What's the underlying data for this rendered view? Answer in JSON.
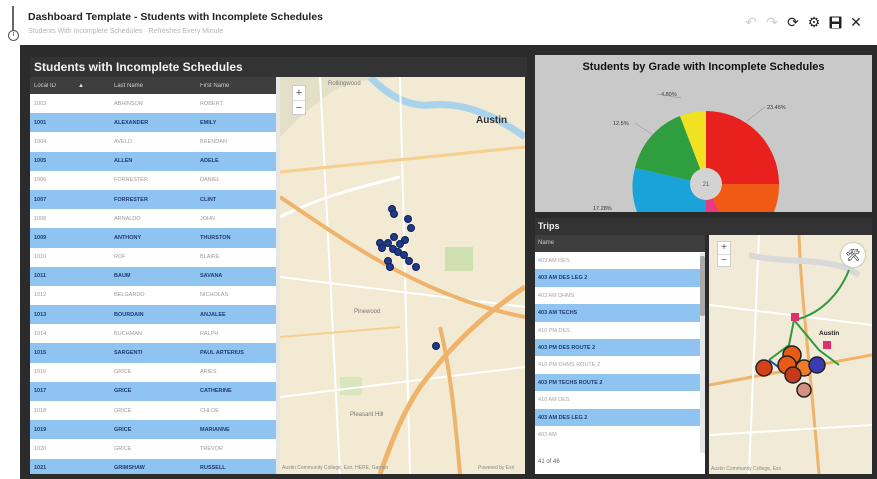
{
  "header": {
    "title": "Dashboard Template - Students with Incomplete Schedules",
    "subtitle": "Students With Incomplete Schedules · Refreshes Every Minute",
    "info_glyph": "i"
  },
  "toolbar": {
    "undo_icon": "↶",
    "redo_icon": "↷",
    "refresh_icon": "⟳",
    "settings_icon": "⚙",
    "save_icon": "💾",
    "close_icon": "✕"
  },
  "students_panel": {
    "title": "Students with Incomplete Schedules",
    "columns": [
      "Local ID",
      "Last Name",
      "First Name"
    ],
    "sort_icon": "▲",
    "rows": [
      {
        "id": "1003",
        "last": "Abhinson",
        "first": "Robert",
        "hl": false
      },
      {
        "id": "1001",
        "last": "Alexander",
        "first": "Emily",
        "hl": true
      },
      {
        "id": "1004",
        "last": "Avelo",
        "first": "Brendan",
        "hl": false
      },
      {
        "id": "1005",
        "last": "Allen",
        "first": "Adele",
        "hl": true
      },
      {
        "id": "1006",
        "last": "Forrester",
        "first": "Daniel",
        "hl": false
      },
      {
        "id": "1007",
        "last": "Forrester",
        "first": "Clint",
        "hl": true
      },
      {
        "id": "1008",
        "last": "Arnaldo",
        "first": "John",
        "hl": false
      },
      {
        "id": "1009",
        "last": "Anthony",
        "first": "Thurston",
        "hl": true
      },
      {
        "id": "1010",
        "last": "Rof",
        "first": "Blaire",
        "hl": false
      },
      {
        "id": "1011",
        "last": "Baum",
        "first": "Savana",
        "hl": true
      },
      {
        "id": "1012",
        "last": "Belgardo",
        "first": "Nicholas",
        "hl": false
      },
      {
        "id": "1013",
        "last": "Bourdain",
        "first": "Anjalee",
        "hl": true
      },
      {
        "id": "1014",
        "last": "Buchman",
        "first": "Ralph",
        "hl": false
      },
      {
        "id": "1015",
        "last": "Sargenti",
        "first": "Paul Arterius",
        "hl": true
      },
      {
        "id": "1016",
        "last": "Grice",
        "first": "Aries",
        "hl": false
      },
      {
        "id": "1017",
        "last": "Grice",
        "first": "Catherine",
        "hl": true
      },
      {
        "id": "1018",
        "last": "Grice",
        "first": "Chloe",
        "hl": false
      },
      {
        "id": "1019",
        "last": "Grice",
        "first": "Marianne",
        "hl": true
      },
      {
        "id": "1020",
        "last": "Grice",
        "first": "Trevor",
        "hl": false
      },
      {
        "id": "1021",
        "last": "Grimshaw",
        "first": "Russell",
        "hl": true
      }
    ]
  },
  "map1": {
    "city_label": "Austin",
    "place_labels": [
      "Rollingwood",
      "Pleasant Hill",
      "Pinewood"
    ],
    "zoom_in": "+",
    "zoom_out": "−",
    "attribution_left": "Austin Community College, Esri, HERE, Garmin",
    "attribution_right": "Powered by Esri",
    "marker_color": "#1f3a8a"
  },
  "pie_panel": {
    "title": "Students by Grade with Incomplete Schedules",
    "center_label": "21",
    "labels": [
      "4.80%",
      "12.5%",
      "17.28%",
      "23.46%"
    ],
    "colors": [
      "#e8201e",
      "#f05a14",
      "#e8387f",
      "#1aa3d9",
      "#2e9e3f",
      "#f0e220"
    ]
  },
  "trips_panel": {
    "title": "Trips",
    "column": "Name",
    "items": [
      {
        "label": "403 AM DES",
        "hl": false
      },
      {
        "label": "403 AM DES LEG 2",
        "hl": true
      },
      {
        "label": "403 AM DHMS",
        "hl": false
      },
      {
        "label": "403 AM TECHS",
        "hl": true
      },
      {
        "label": "410 PM DES",
        "hl": false
      },
      {
        "label": "403 PM DES ROUTE 2",
        "hl": true
      },
      {
        "label": "410 PM DHMS ROUTE 2",
        "hl": false
      },
      {
        "label": "403 PM TECHS ROUTE 2",
        "hl": true
      },
      {
        "label": "410 AM DES",
        "hl": false
      },
      {
        "label": "403 AM DES LEG 2",
        "hl": true
      },
      {
        "label": "403 AM",
        "hl": false
      }
    ],
    "count": "41 of 46",
    "tool_icon": "🛠",
    "city_label": "Austin",
    "attribution": "Austin Community College, Esri"
  }
}
